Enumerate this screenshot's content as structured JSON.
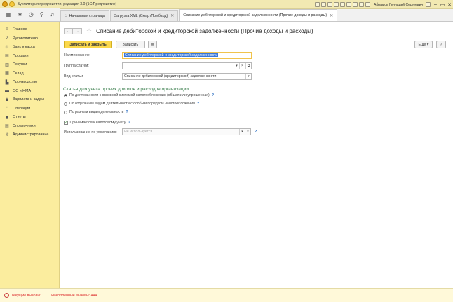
{
  "titlebar": {
    "title": "Бухгалтерия предприятия, редакция 3.0  (1С:Предприятие)",
    "user": "Абрамов Геннадий Сергеевич"
  },
  "tabs": [
    {
      "label": "Начальная страница",
      "icon": "home-icon"
    },
    {
      "label": "Загрузка XML (СмартПомбард)"
    },
    {
      "label": "Списание дебиторской и кредиторской задолженности (Прочие доходы и расходы)",
      "active": true
    }
  ],
  "sidebar": {
    "items": [
      {
        "label": "Главное",
        "icon": "menu-icon"
      },
      {
        "label": "Руководителю",
        "icon": "trend-icon"
      },
      {
        "label": "Банк и касса",
        "icon": "bank-icon"
      },
      {
        "label": "Продажи",
        "icon": "sales-icon"
      },
      {
        "label": "Покупки",
        "icon": "cart-icon"
      },
      {
        "label": "Склад",
        "icon": "warehouse-icon"
      },
      {
        "label": "Производство",
        "icon": "factory-icon"
      },
      {
        "label": "ОС и НМА",
        "icon": "assets-icon"
      },
      {
        "label": "Зарплата и кадры",
        "icon": "people-icon"
      },
      {
        "label": "Операции",
        "icon": "operations-icon"
      },
      {
        "label": "Отчеты",
        "icon": "reports-icon"
      },
      {
        "label": "Справочники",
        "icon": "book-icon"
      },
      {
        "label": "Администрирование",
        "icon": "gear-icon"
      }
    ]
  },
  "page": {
    "title": "Списание дебиторской и кредиторской задолженности (Прочие доходы и расходы)"
  },
  "toolbar": {
    "save_close": "Записать и закрыть",
    "save": "Записать",
    "more": "Еще",
    "help": "?"
  },
  "form": {
    "name_label": "Наименование:",
    "name_value": "Списание дебиторской и кредиторской задолженности",
    "group_label": "Группа статей:",
    "group_value": "",
    "type_label": "Вид статьи:",
    "type_value": "Списание дебиторской (кредиторской) задолженности",
    "section_title": "Статья для учета прочих доходов и расходов организации",
    "radio_1": "По деятельности с основной системой налогообложения (общая или упрощенная)",
    "radio_2": "По отдельным видам деятельности с особым порядком налогообложения",
    "radio_3": "По разным видам деятельности",
    "tax_check": "Принимается к налоговому учету",
    "default_label": "Использование по умолчанию:",
    "default_placeholder": "Не используется"
  },
  "statusbar": {
    "current": "Текущие вызовы: 1",
    "accumulated": "Накопленные вызовы: 444"
  }
}
